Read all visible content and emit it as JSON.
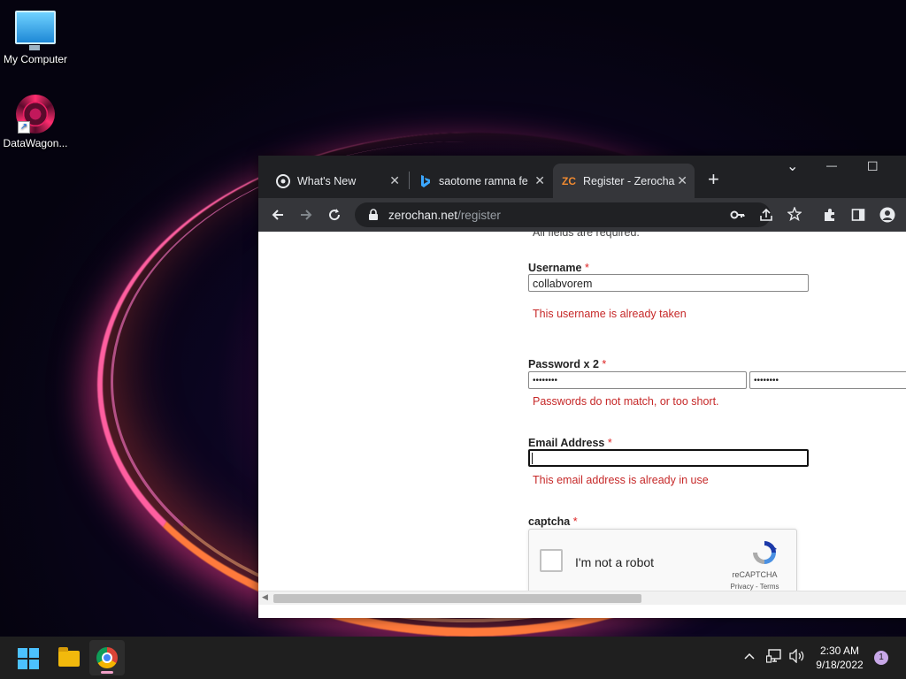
{
  "desktop": {
    "icons": [
      {
        "label": "My Computer",
        "icon": "computer-icon"
      },
      {
        "label": "DataWagon...",
        "icon": "datawagon-icon"
      }
    ]
  },
  "browser": {
    "tabs": [
      {
        "title": "What's New",
        "icon": "chrome-icon",
        "close": "✕",
        "active": false
      },
      {
        "title": "saotome ramna fe",
        "icon": "bing-icon",
        "close": "✕",
        "active": false
      },
      {
        "title": "Register - Zerocha",
        "icon": "zerochan-icon",
        "close": "✕",
        "active": true
      }
    ],
    "new_tab": "+",
    "window_controls": {
      "tab_search": "⌄",
      "minimize": "—",
      "maximize": "☐"
    },
    "address": {
      "domain": "zerochan.net",
      "path": "/register"
    },
    "toolbar_icons": [
      "back-icon",
      "forward-icon",
      "reload-icon",
      "lock-icon",
      "key-icon",
      "share-icon",
      "star-icon",
      "extensions-icon",
      "side-panel-icon",
      "profile-icon"
    ]
  },
  "form": {
    "note": "All fields are required.",
    "required_marker": "*",
    "username": {
      "label": "Username",
      "value": "collabvorem",
      "error": "This username is already taken"
    },
    "password": {
      "label": "Password x 2",
      "value1": "••••••••",
      "value2": "••••••••",
      "error": "Passwords do not match, or too short."
    },
    "email": {
      "label": "Email Address",
      "value": "",
      "error": "This email address is already in use"
    },
    "captcha": {
      "label": "captcha",
      "checkbox_text": "I'm not a robot",
      "brand": "reCAPTCHA",
      "links": "Privacy - Terms"
    }
  },
  "taskbar": {
    "apps": [
      "start-icon",
      "file-explorer-icon",
      "chrome-icon"
    ],
    "tray": {
      "chevron": "^"
    },
    "clock": {
      "time": "2:30 AM",
      "date": "9/18/2022"
    },
    "notifications": "1"
  },
  "colors": {
    "error": "#c62828",
    "required": "#dd2222",
    "accent": "#4cc2ff"
  }
}
